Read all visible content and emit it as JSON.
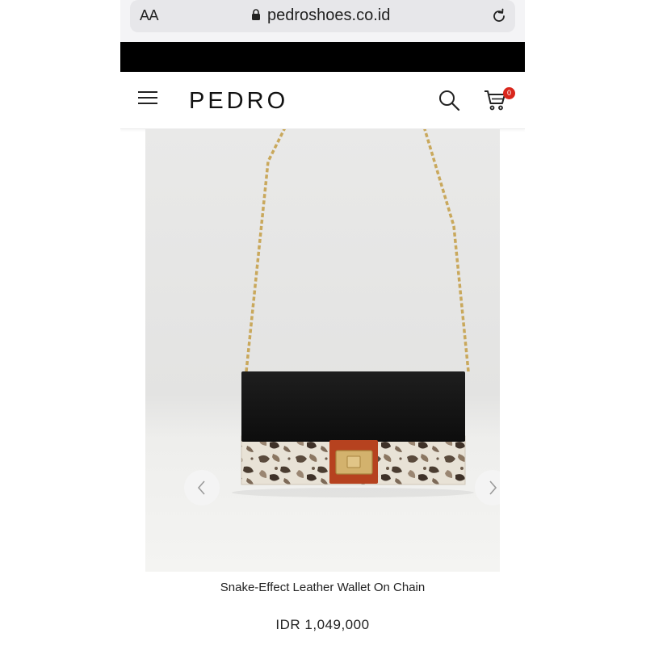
{
  "browser": {
    "text_size_label": "AA",
    "url": "pedroshoes.co.id"
  },
  "header": {
    "logo": "PEDRO",
    "cart_count": "0"
  },
  "product": {
    "name": "Snake-Effect Leather Wallet On Chain",
    "price": "IDR 1,049,000"
  },
  "colors": {
    "badge": "#d9261c",
    "strap_gold": "#c9a85c",
    "flap": "#141414",
    "clasp_accent": "#b6421f"
  },
  "icons": [
    "lock-icon",
    "reload-icon",
    "menu-icon",
    "search-icon",
    "cart-icon",
    "chevron-left-icon",
    "chevron-right-icon"
  ]
}
